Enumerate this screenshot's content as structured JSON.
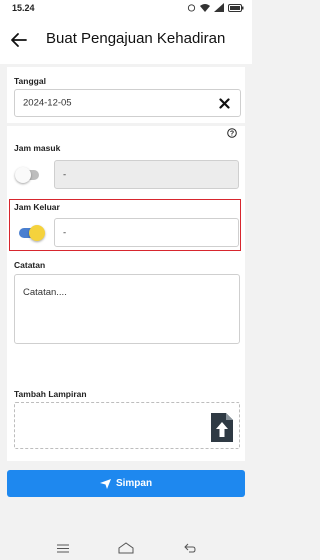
{
  "status_bar": {
    "time": "15.24",
    "battery_icon": "battery-icon"
  },
  "header": {
    "title": "Buat Pengajuan Kehadiran",
    "back_icon": "arrow-left-icon"
  },
  "form": {
    "tanggal": {
      "label": "Tanggal",
      "value": "2024-12-05"
    },
    "jam_masuk": {
      "label": "Jam masuk",
      "value": "-",
      "toggle_on": false
    },
    "jam_keluar": {
      "label": "Jam Keluar",
      "value": "-",
      "toggle_on": true
    },
    "catatan": {
      "label": "Catatan",
      "placeholder": "Catatan...."
    },
    "lampiran": {
      "label": "Tambah Lampiran",
      "icon": "file-upload-icon"
    }
  },
  "actions": {
    "save_label": "Simpan",
    "save_icon": "send-icon"
  },
  "colors": {
    "primary": "#1e88ef",
    "highlight": "#d7262e",
    "toggle_knob_on": "#f5d23c",
    "toggle_track_on": "#4a7fd0"
  }
}
